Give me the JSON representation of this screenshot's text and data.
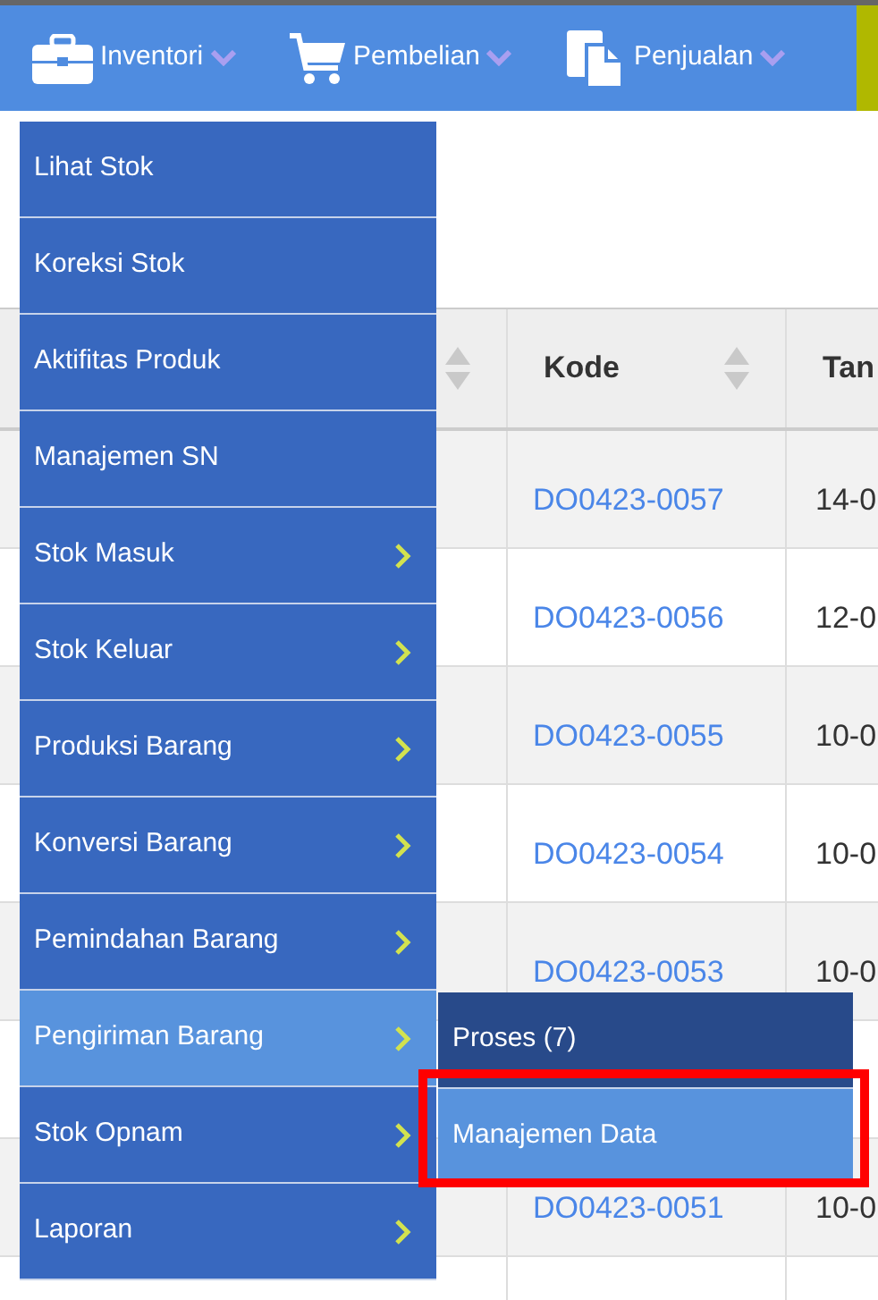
{
  "menubar": {
    "items": [
      {
        "label": "Inventori"
      },
      {
        "label": "Pembelian"
      },
      {
        "label": "Penjualan"
      }
    ]
  },
  "table": {
    "columns": [
      {
        "sortable": true
      },
      {
        "label": "Kode",
        "sortable": true
      },
      {
        "label": "Tan",
        "sortable": false
      }
    ],
    "rows": [
      {
        "kode": "DO0423-0057",
        "date": "14-0"
      },
      {
        "kode": "DO0423-0056",
        "date": "12-0"
      },
      {
        "kode": "DO0423-0055",
        "date": "10-0"
      },
      {
        "kode": "DO0423-0054",
        "date": "10-0"
      },
      {
        "kode": "DO0423-0053",
        "date": "10-0"
      },
      {},
      {
        "kode": "DO0423-0051",
        "date": "10-0"
      },
      {}
    ]
  },
  "dropdown": {
    "items": [
      {
        "label": "Lihat Stok",
        "has_submenu": false,
        "selected": false
      },
      {
        "label": "Koreksi Stok",
        "has_submenu": false,
        "selected": false
      },
      {
        "label": "Aktifitas Produk",
        "has_submenu": false,
        "selected": false
      },
      {
        "label": "Manajemen SN",
        "has_submenu": false,
        "selected": false
      },
      {
        "label": "Stok Masuk",
        "has_submenu": true,
        "selected": false
      },
      {
        "label": "Stok Keluar",
        "has_submenu": true,
        "selected": false
      },
      {
        "label": "Produksi Barang",
        "has_submenu": true,
        "selected": false
      },
      {
        "label": "Konversi Barang",
        "has_submenu": true,
        "selected": false
      },
      {
        "label": "Pemindahan Barang",
        "has_submenu": true,
        "selected": false
      },
      {
        "label": "Pengiriman Barang",
        "has_submenu": true,
        "selected": true
      },
      {
        "label": "Stok Opnam",
        "has_submenu": true,
        "selected": false
      },
      {
        "label": "Laporan",
        "has_submenu": true,
        "selected": false
      }
    ]
  },
  "submenu": {
    "items": [
      {
        "label": "Proses (7)",
        "selected": false
      },
      {
        "label": "Manajemen Data",
        "selected": true
      }
    ]
  }
}
